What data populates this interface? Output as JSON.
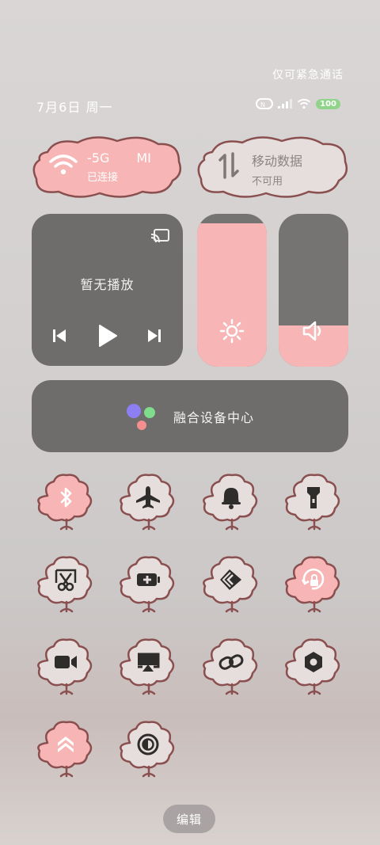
{
  "header": {
    "emergency_text": "仅可紧急通话",
    "date_text": "7月6日 周一",
    "battery_level": "100"
  },
  "wifi_tile": {
    "title": "-5G",
    "title_extra": "MI",
    "status": "已连接",
    "active": true
  },
  "mobile_tile": {
    "title": "移动数据",
    "status": "不可用",
    "active": false
  },
  "media": {
    "title": "暂无播放"
  },
  "brightness": {
    "level_percent": 94
  },
  "volume": {
    "level_percent": 27
  },
  "device_hub": {
    "label": "融合设备中心"
  },
  "tiles": [
    {
      "name": "bluetooth",
      "active": true
    },
    {
      "name": "airplane",
      "active": false
    },
    {
      "name": "bell",
      "active": false
    },
    {
      "name": "flashlight",
      "active": false
    },
    {
      "name": "screenshot",
      "active": false
    },
    {
      "name": "battery-saver",
      "active": false
    },
    {
      "name": "share",
      "active": false
    },
    {
      "name": "rotation-lock",
      "active": true
    },
    {
      "name": "screen-record",
      "active": false
    },
    {
      "name": "screen-cast",
      "active": false
    },
    {
      "name": "link",
      "active": false
    },
    {
      "name": "settings",
      "active": false
    },
    {
      "name": "performance",
      "active": true
    },
    {
      "name": "dark-mode",
      "active": false
    }
  ],
  "footer": {
    "edit_label": "编辑"
  },
  "colors": {
    "accent_pink": "#f7b6b5",
    "inactive_tile": "#e6dedd",
    "cloud_outline": "#8a4f4f",
    "card_gray": "#6f6d6c"
  }
}
